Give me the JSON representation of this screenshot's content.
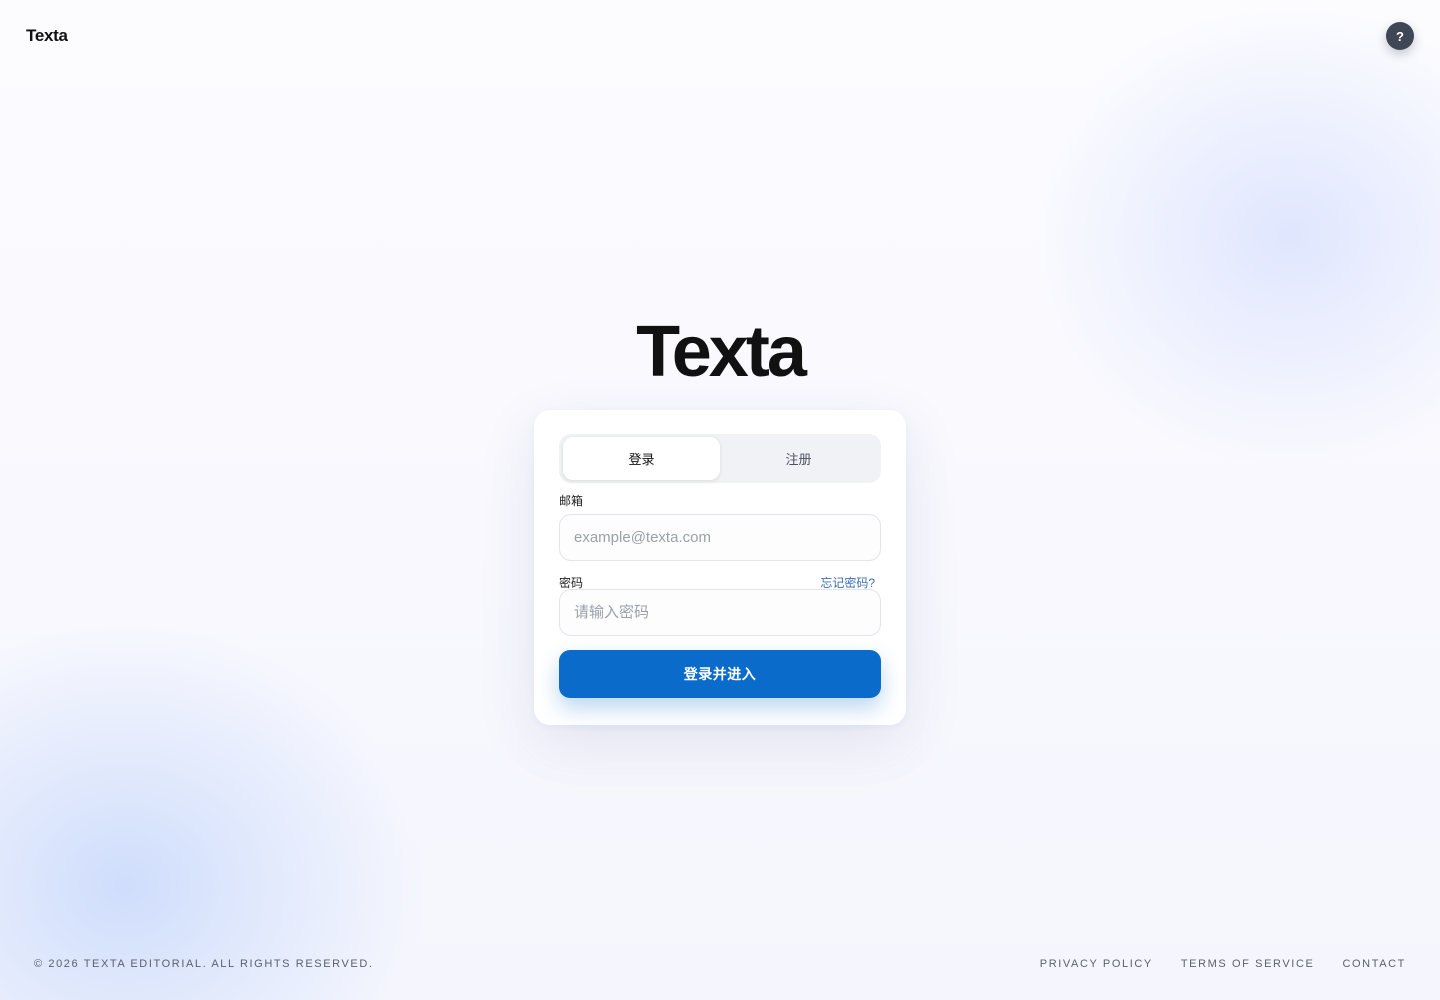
{
  "header": {
    "logo": "Texta",
    "help_label": "?"
  },
  "brand": {
    "title": "Texta"
  },
  "auth": {
    "tabs": [
      {
        "label": "登录",
        "active": true
      },
      {
        "label": "注册",
        "active": false
      }
    ],
    "email": {
      "label": "邮箱",
      "value": "",
      "placeholder": "example@texta.com"
    },
    "password": {
      "label": "密码",
      "value": "",
      "placeholder": "请输入密码",
      "forgot_label": "忘记密码?"
    },
    "submit_label": "登录并进入"
  },
  "footer": {
    "copyright": "© 2026 TEXTA EDITORIAL. ALL RIGHTS RESERVED.",
    "links": [
      "PRIVACY POLICY",
      "TERMS OF SERVICE",
      "CONTACT"
    ]
  },
  "colors": {
    "primary": "#0a6bcb",
    "help_button": "#3f4654",
    "link": "#3d6fb3",
    "text": "#111111"
  },
  "icons": {
    "help": "question-mark-icon"
  }
}
